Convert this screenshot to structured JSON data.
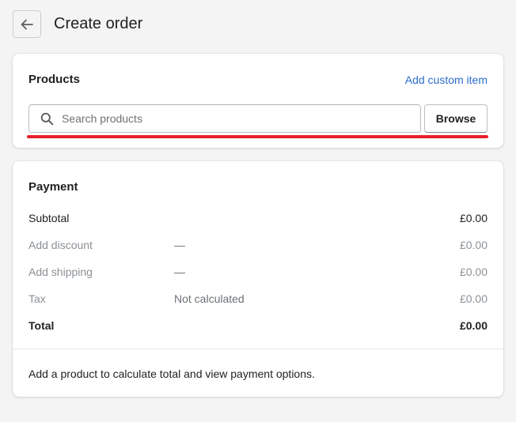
{
  "header": {
    "back_icon": "arrow-left-icon",
    "title": "Create order"
  },
  "products": {
    "title": "Products",
    "add_custom_item": "Add custom item",
    "search_icon": "search-icon",
    "search_placeholder": "Search products",
    "search_value": "",
    "browse_label": "Browse",
    "highlight_color": "#e8202a"
  },
  "payment": {
    "title": "Payment",
    "rows": [
      {
        "label": "Subtotal",
        "detail": "",
        "amount": "£0.00"
      },
      {
        "label": "Add discount",
        "detail": "—",
        "amount": "£0.00"
      },
      {
        "label": "Add shipping",
        "detail": "—",
        "amount": "£0.00"
      },
      {
        "label": "Tax",
        "detail": "Not calculated",
        "amount": "£0.00"
      },
      {
        "label": "Total",
        "detail": "",
        "amount": "£0.00"
      }
    ],
    "footer": "Add a product to calculate total and view payment options."
  },
  "colors": {
    "link": "#2c6ecb",
    "background": "#f4f4f4"
  }
}
